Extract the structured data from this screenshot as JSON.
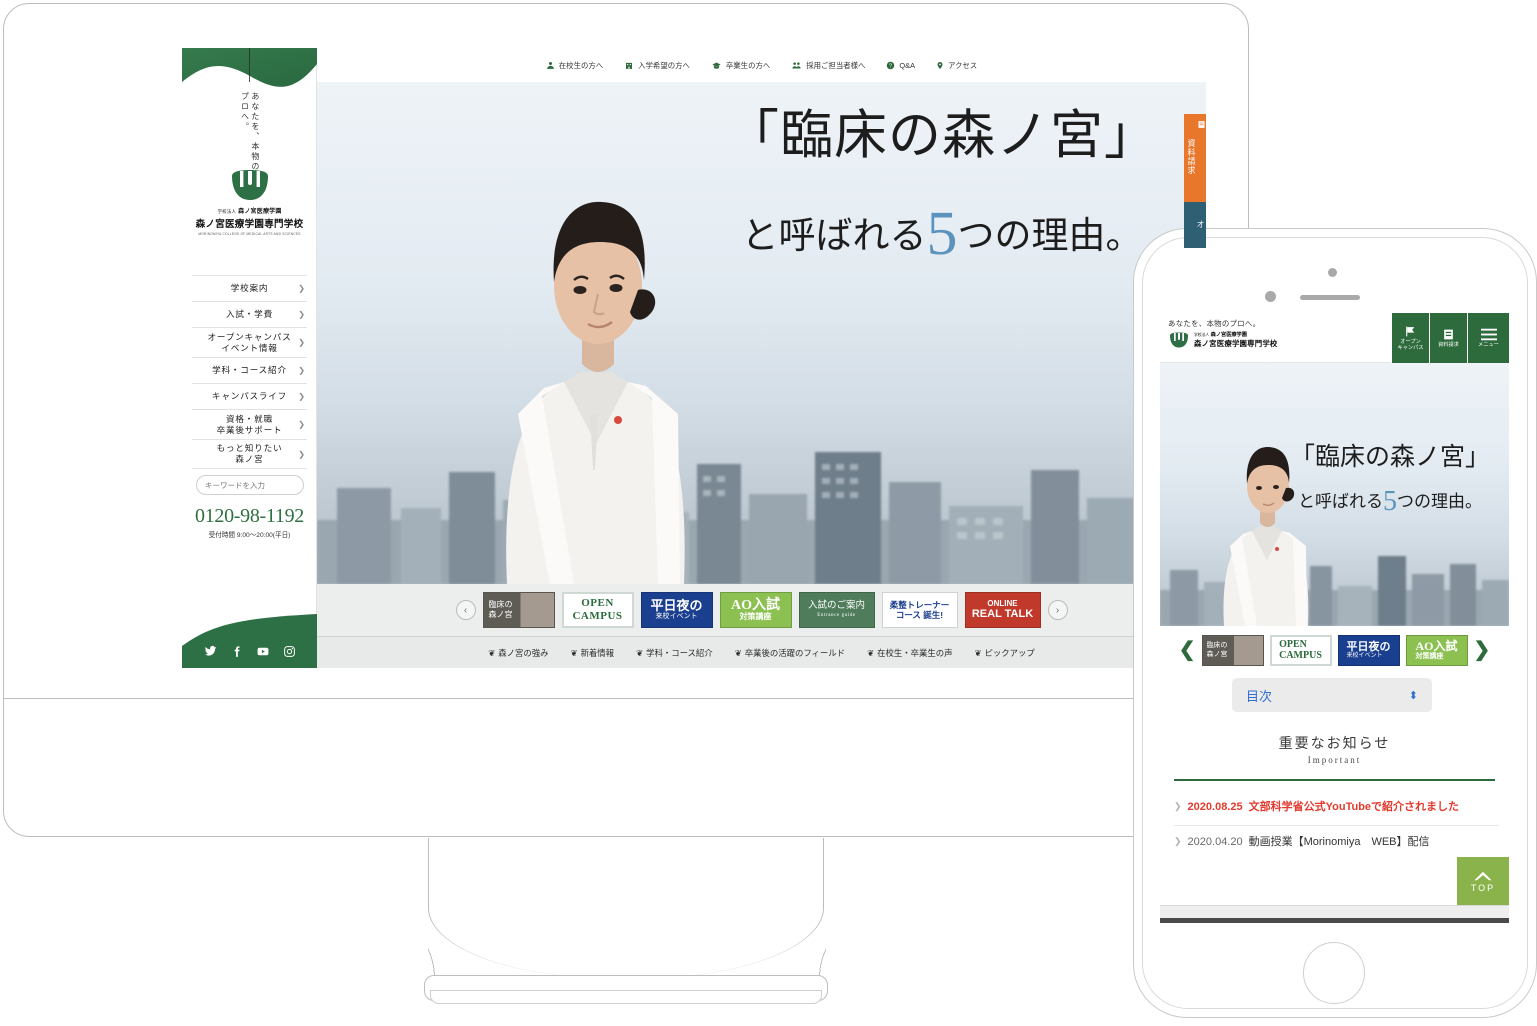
{
  "desktop": {
    "sidebar": {
      "tagline": "あなたを、本物のプロへ。",
      "logo": {
        "corp_prefix": "学校法人",
        "corp_name": "森ノ宮医療学園",
        "school_name": "森ノ宮医療学園専門学校",
        "english": "MORINOMIYA COLLEGE OF MEDICAL ARTS AND SCIENCES"
      },
      "nav": [
        {
          "label": "学校案内"
        },
        {
          "label": "入試・学費"
        },
        {
          "label": "オープンキャンパス\nイベント情報"
        },
        {
          "label": "学科・コース紹介"
        },
        {
          "label": "キャンパスライフ"
        },
        {
          "label": "資格・就職\n卒業後サポート"
        },
        {
          "label": "もっと知りたい\n森ノ宮"
        }
      ],
      "search": {
        "placeholder": "キーワードを入力",
        "value": ""
      },
      "tel": {
        "number": "0120-98-1192",
        "hours": "受付時間 9:00〜20:00(平日)"
      },
      "social": [
        "twitter-icon",
        "facebook-icon",
        "youtube-icon",
        "instagram-icon"
      ]
    },
    "utility_nav": [
      {
        "label": "在校生の方へ",
        "icon": "person-icon"
      },
      {
        "label": "入学希望の方へ",
        "icon": "building-icon"
      },
      {
        "label": "卒業生の方へ",
        "icon": "graduation-cap-icon"
      },
      {
        "label": "採用ご担当者様へ",
        "icon": "people-icon"
      },
      {
        "label": "Q&A",
        "icon": "question-circle-icon"
      },
      {
        "label": "アクセス",
        "icon": "map-pin-icon"
      }
    ],
    "hero": {
      "line1": "「臨床の森ノ宮」",
      "line2_before": "と呼ばれる",
      "line2_number": "5",
      "line2_after": "つの理由。"
    },
    "carousel": {
      "prev_label": "‹",
      "next_label": "›",
      "banners": [
        {
          "name": "rinsho",
          "line1": "臨床の",
          "line2": "森ノ宮",
          "bg": "#6d6a62",
          "color": "#ffffff"
        },
        {
          "name": "open-campus",
          "line1": "OPEN",
          "line2": "CAMPUS",
          "bg": "#ffffff",
          "color": "#2c6b3d"
        },
        {
          "name": "heijitsu-yoru",
          "line1": "平日夜の",
          "line2": "来校イベント",
          "bg": "#1b3f8f",
          "color": "#ffffff"
        },
        {
          "name": "ao-nyushi",
          "line1": "AO入試",
          "line2": "対策講座",
          "bg": "#8cc152",
          "color": "#ffffff"
        },
        {
          "name": "entrance-guide",
          "line1": "入試のご案内",
          "line2": "Entrance guide",
          "bg": "#4f7c5a",
          "color": "#ffffff"
        },
        {
          "name": "juusei-trainer",
          "line1": "柔整トレーナー",
          "line2": "コース 誕生!",
          "bg": "#ffffff",
          "color": "#1b3f8f"
        },
        {
          "name": "online-real-talk",
          "line1": "ONLINE",
          "line2": "REAL TALK",
          "bg": "#c0392b",
          "color": "#ffffff"
        }
      ]
    },
    "footer_nav": [
      {
        "label": "森ノ宮の強み"
      },
      {
        "label": "新着情報"
      },
      {
        "label": "学科・コース紹介"
      },
      {
        "label": "卒業後の活躍のフィールド"
      },
      {
        "label": "在校生・卒業生の声"
      },
      {
        "label": "ピックアップ"
      }
    ],
    "side_tabs": [
      {
        "label": "資料請求",
        "icon": "document-icon",
        "color": "#e8762b"
      },
      {
        "label": "オ",
        "icon": "flag-icon",
        "color": "#2e5f72"
      }
    ]
  },
  "mobile": {
    "header": {
      "tagline": "あなたを、本物のプロへ。",
      "corp_prefix": "学校法人",
      "corp_name": "森ノ宮医療学園",
      "school_name": "森ノ宮医療学園専門学校",
      "buttons": [
        {
          "label": "オープン\nキャンパス",
          "icon": "flag-icon"
        },
        {
          "label": "資料請求",
          "icon": "document-icon"
        },
        {
          "label": "メニュー",
          "icon": "hamburger-icon"
        }
      ]
    },
    "hero": {
      "line1": "「臨床の森ノ宮」",
      "line2_before": "と呼ばれる",
      "line2_number": "5",
      "line2_after": "つの理由。"
    },
    "carousel": {
      "prev_label": "❮",
      "next_label": "❯",
      "banners": [
        {
          "name": "rinsho",
          "line1": "臨床の",
          "line2": "森ノ宮",
          "bg": "#6d6a62",
          "color": "#ffffff"
        },
        {
          "name": "open-campus",
          "line1": "OPEN",
          "line2": "CAMPUS",
          "bg": "#ffffff",
          "color": "#2c6b3d"
        },
        {
          "name": "heijitsu-yoru",
          "line1": "平日夜の",
          "line2": "来校イベント",
          "bg": "#1b3f8f",
          "color": "#ffffff"
        },
        {
          "name": "ao-nyushi",
          "line1": "AO入試",
          "line2": "対策講座",
          "bg": "#8cc152",
          "color": "#ffffff"
        }
      ]
    },
    "toc_select": {
      "value": "目次"
    },
    "important": {
      "title_jp": "重要なお知らせ",
      "title_en": "Important"
    },
    "news": [
      {
        "date": "2020.08.25",
        "text": "文部科学省公式YouTubeで紹介されました",
        "highlight": true
      },
      {
        "date": "2020.04.20",
        "text": "動画授業【Morinomiya　WEB】配信",
        "highlight": false
      }
    ],
    "top_button": {
      "label": "TOP",
      "icon": "chevron-up-icon"
    }
  },
  "colors": {
    "brand_green": "#2e6b3c",
    "accent_orange": "#e8762b",
    "accent_teal": "#2e5f72",
    "hero_blue": "#5b93bd",
    "news_red": "#e23b2e",
    "top_green": "#8ab44b"
  }
}
